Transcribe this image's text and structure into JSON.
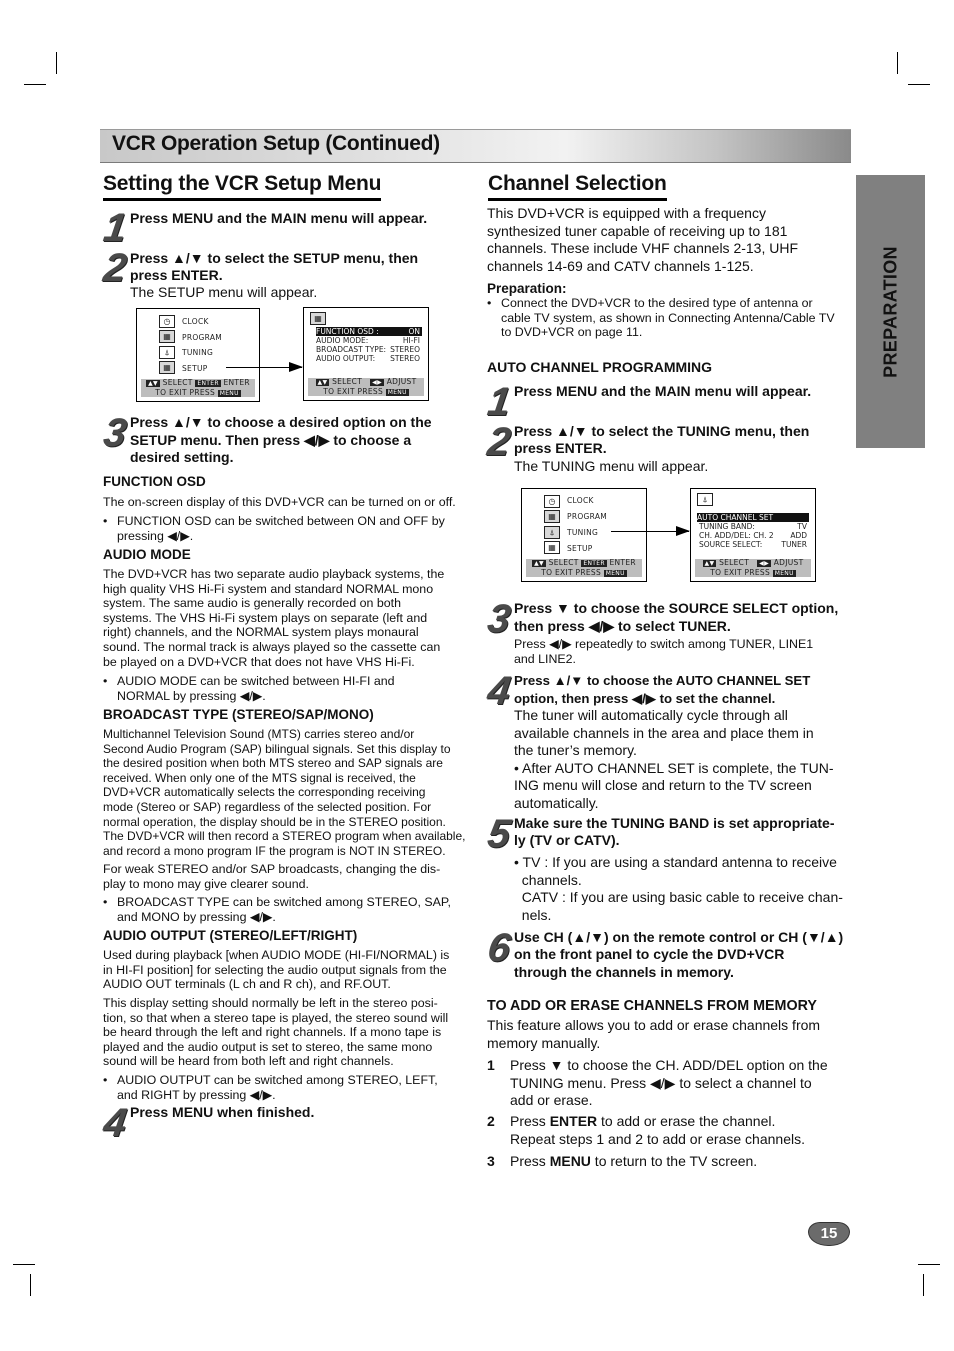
{
  "banner": {
    "title": "VCR Operation Setup (Continued)"
  },
  "side_tab": {
    "label": "PREPARATION"
  },
  "page_number": "15",
  "left": {
    "heading": "Setting the VCR Setup Menu",
    "steps": [
      {
        "num": "1",
        "text": "Press MENU and the MAIN menu will appear."
      },
      {
        "num": "2",
        "text_line1": "Press ▲/▼ to select the SETUP menu, then",
        "text_line2": "press ENTER.",
        "note": "The SETUP menu will appear."
      },
      {
        "num": "3",
        "text_line1": "Press ▲/▼ to choose a desired option on the",
        "text_line2": "SETUP menu. Then press ◀/▶ to choose a",
        "text_line3": "desired setting."
      },
      {
        "num": "4",
        "text": "Press MENU when finished."
      }
    ],
    "main_menu": {
      "items": [
        "CLOCK",
        "PROGRAM",
        "TUNING",
        "SETUP"
      ],
      "footer_line1_a": "SELECT",
      "footer_enter_key": "ENTER",
      "footer_line1_b": "ENTER",
      "footer_line2": "TO EXIT PRESS",
      "footer_menu_key": "MENU"
    },
    "setup_menu": {
      "options": [
        {
          "label": "FUNCTION OSD :",
          "value": "ON",
          "selected": true
        },
        {
          "label": "AUDIO MODE:",
          "value": "HI-FI"
        },
        {
          "label": "BROADCAST TYPE:",
          "value": "STEREO"
        },
        {
          "label": "AUDIO OUTPUT:",
          "value": "STEREO"
        }
      ],
      "footer_select": "SELECT",
      "footer_adjust": "ADJUST",
      "footer_line2": "TO EXIT PRESS",
      "footer_menu_key": "MENU"
    },
    "function_osd": {
      "title": "FUNCTION OSD",
      "body": "The on-screen display of this DVD+VCR can be turned on or off.",
      "bullet_l1": "FUNCTION OSD can be switched between ON and OFF by",
      "bullet_l2": "pressing ◀/▶."
    },
    "audio_mode": {
      "title": "AUDIO MODE",
      "lines": [
        "The DVD+VCR has two separate audio playback systems, the",
        "high quality VHS Hi-Fi system and standard NORMAL mono",
        "system. The same audio is generally recorded on both",
        "systems. The VHS Hi-Fi system plays on separate (left and",
        "right) channels, and the NORMAL system plays monaural",
        "sound. The normal track is always played so the cassette can",
        "be played on a DVD+VCR that does not have VHS Hi-Fi."
      ],
      "bullet_l1": "AUDIO MODE can be switched between HI-FI and",
      "bullet_l2": "NORMAL by pressing ◀/▶."
    },
    "broadcast_type": {
      "title": "BROADCAST TYPE (STEREO/SAP/MONO)",
      "lines": [
        "Multichannel Television Sound (MTS) carries stereo and/or",
        "Second Audio Program (SAP) bilingual signals. Set this display to",
        "the desired position when both MTS stereo and SAP signals are",
        "received. When only one of the MTS signal is received, the",
        "DVD+VCR automatically selects the corresponding receiving",
        "mode (Stereo or SAP) regardless of the selected position. For",
        "normal operation, the display should be in the STEREO position.",
        "The DVD+VCR will then record a STEREO program when available,",
        "and record a mono program IF the program is NOT IN STEREO."
      ],
      "para2_l1": "For weak STEREO and/or SAP broadcasts, changing the dis-",
      "para2_l2": "play to mono may give clearer sound.",
      "bullet_l1": "BROADCAST TYPE can be switched among STEREO, SAP,",
      "bullet_l2": "and MONO by pressing ◀/▶."
    },
    "audio_output": {
      "title": "AUDIO OUTPUT (STEREO/LEFT/RIGHT)",
      "lines": [
        "Used during playback [when AUDIO MODE (HI-FI/NORMAL) is",
        "in HI-FI position] for selecting the audio output signals from the",
        "AUDIO OUT terminals (L ch and R ch), and RF.OUT."
      ],
      "lines2": [
        "This display setting should normally be left in the stereo posi-",
        "tion, so that when a stereo tape is played, the stereo sound will",
        "be heard through the left and right channels. If a mono tape is",
        "played and the audio output is set to stereo, the same mono",
        "sound will be heard from both left and right channels."
      ],
      "bullet_l1": "AUDIO OUTPUT can be switched among STEREO, LEFT,",
      "bullet_l2": "and RIGHT by pressing ◀/▶."
    }
  },
  "right": {
    "heading": "Channel Selection",
    "intro": [
      "This DVD+VCR is equipped with a frequency",
      "synthesized tuner capable of receiving up to 181",
      "channels. These include VHF channels 2-13, UHF",
      "channels 14-69 and CATV channels 1-125."
    ],
    "preparation_title": "Preparation:",
    "preparation_lines": [
      "Connect the DVD+VCR to the desired type of antenna or",
      "cable TV system, as shown in Connecting Antenna/Cable TV",
      "to DVD+VCR on page 11."
    ],
    "auto_title": "AUTO CHANNEL PROGRAMMING",
    "steps": [
      {
        "num": "1",
        "text": "Press MENU and the MAIN menu will appear."
      },
      {
        "num": "2",
        "text_line1": "Press ▲/▼ to select the TUNING menu, then",
        "text_line2": "press ENTER.",
        "note": "The TUNING menu will appear."
      },
      {
        "num": "3",
        "text_line1": "Press ▼ to choose the SOURCE SELECT option,",
        "text_line2": "then press ◀/▶ to select TUNER.",
        "note_l1": "Press ◀/▶ repeatedly to switch among TUNER, LINE1",
        "note_l2": "and LINE2."
      },
      {
        "num": "4",
        "text_line1": "Press ▲/▼ to choose the AUTO CHANNEL SET",
        "text_line2": "option, then press ◀/▶ to set the channel.",
        "body": [
          "The tuner will automatically cycle through all",
          "available channels in the area and place them in",
          "the tuner’s memory.",
          "• After AUTO CHANNEL SET is complete, the TUN-",
          "ING menu will close and return to the TV screen",
          "automatically."
        ]
      },
      {
        "num": "5",
        "text_line1": "Make sure the TUNING BAND is set appropriate-",
        "text_line2": "ly (TV or CATV).",
        "body": [
          "• TV : If you are using a standard antenna to receive",
          "  channels.",
          "  CATV : If you are using basic cable to receive chan-",
          "  nels."
        ]
      },
      {
        "num": "6",
        "text_line1": "Use CH (▲/▼) on the remote control or CH (▼/▲)",
        "text_line2": "on the front panel to cycle the DVD+VCR",
        "text_line3": "through the channels in memory."
      }
    ],
    "main_menu": {
      "items": [
        "CLOCK",
        "PROGRAM",
        "TUNING",
        "SETUP"
      ],
      "footer_line1_a": "SELECT",
      "footer_enter_key": "ENTER",
      "footer_line1_b": "ENTER",
      "footer_line2": "TO EXIT PRESS",
      "footer_menu_key": "MENU"
    },
    "tuning_menu": {
      "options": [
        {
          "label": "AUTO CHANNEL SET",
          "value": "",
          "selected": true
        },
        {
          "label": "TUNING BAND:",
          "value": "TV"
        },
        {
          "label": "CH.  ADD/DEL: CH. 2",
          "value": "ADD"
        },
        {
          "label": "SOURCE  SELECT:",
          "value": "TUNER"
        }
      ],
      "footer_select": "SELECT",
      "footer_adjust": "ADJUST",
      "footer_line2": "TO EXIT PRESS",
      "footer_menu_key": "MENU"
    },
    "add_erase": {
      "title": "TO ADD OR ERASE CHANNELS FROM MEMORY",
      "intro_l1": "This feature allows you to add or erase channels from",
      "intro_l2": "memory manually.",
      "items": [
        {
          "num": "1",
          "l1": "Press ▼ to choose the CH. ADD/DEL option on the",
          "l2": "TUNING menu. Press ◀/▶ to select a channel to",
          "l3": "add or erase."
        },
        {
          "num": "2",
          "l1_a": "Press ",
          "l1_b": "ENTER",
          "l1_c": " to add or erase the channel.",
          "l2": "Repeat steps 1 and 2 to add or erase channels."
        },
        {
          "num": "3",
          "l1_a": "Press ",
          "l1_b": "MENU",
          "l1_c": " to return to the TV screen."
        }
      ]
    }
  }
}
